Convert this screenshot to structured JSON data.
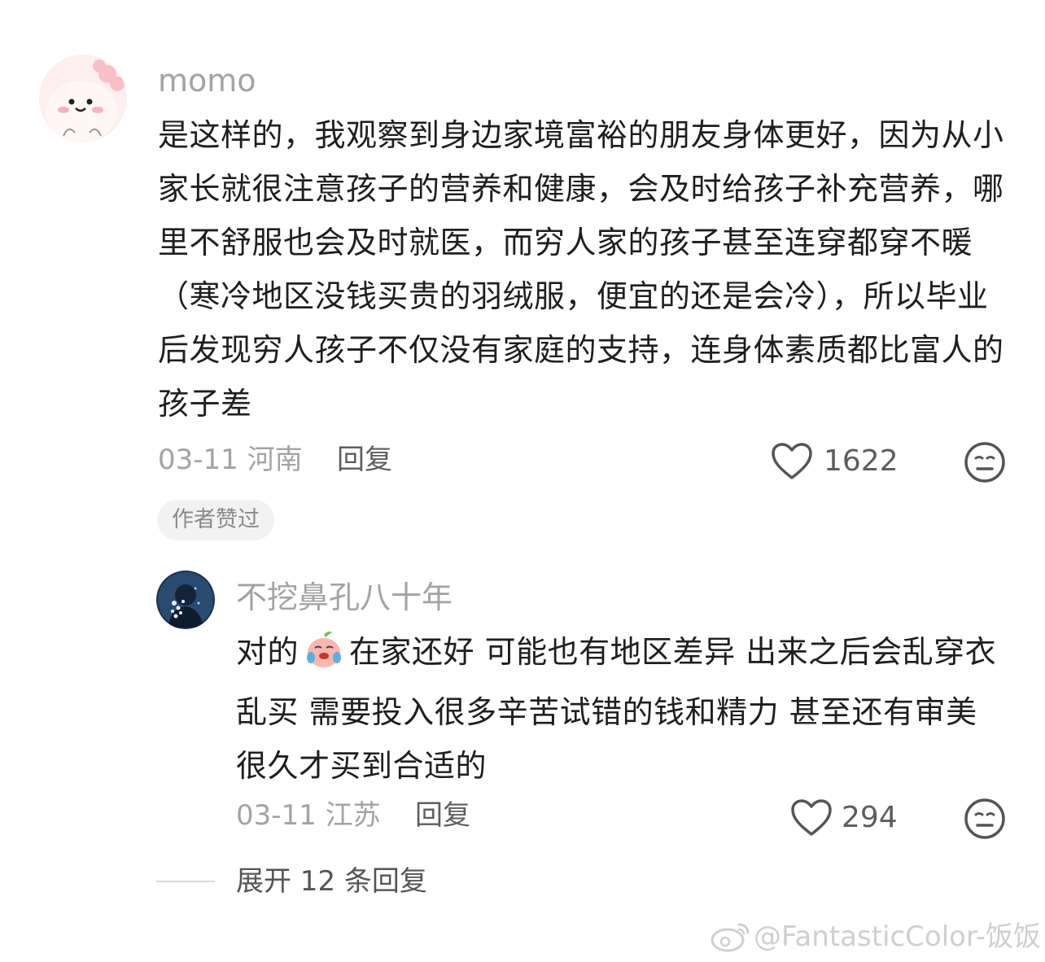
{
  "comments": [
    {
      "username": "momo",
      "content": "是这样的，我观察到身边家境富裕的朋友身体更好，因为从小家长就很注意孩子的营养和健康，会及时给孩子补充营养，哪里不舒服也会及时就医，而穷人家的孩子甚至连穿都穿不暖（寒冷地区没钱买贵的羽绒服，便宜的还是会冷），所以毕业后发现穷人孩子不仅没有家庭的支持，连身体素质都比富人的孩子差",
      "date": "03-11",
      "location": "河南",
      "reply_label": "回复",
      "likes": "1622",
      "badge": "作者赞过"
    },
    {
      "username": "不挖鼻孔八十年",
      "content_before_emoji": "对的",
      "content_after_emoji": "在家还好 可能也有地区差异 出来之后会乱穿衣乱买 需要投入很多辛苦试错的钱和精力 甚至还有审美 很久才买到合适的",
      "date": "03-11",
      "location": "江苏",
      "reply_label": "回复",
      "likes": "294"
    }
  ],
  "expand_replies": "展开 12 条回复",
  "watermark": "@FantasticColor-饭饭",
  "icons": {
    "like": "heart-outline-icon",
    "dislike": "neutral-face-icon",
    "emoji": "crying-peach-emoji",
    "watermark": "weibo-logo-icon"
  },
  "colors": {
    "text": "#1f1f1f",
    "muted": "#a3a3a3",
    "secondary": "#5e5e5e",
    "badge_bg": "#f2f2f2"
  }
}
